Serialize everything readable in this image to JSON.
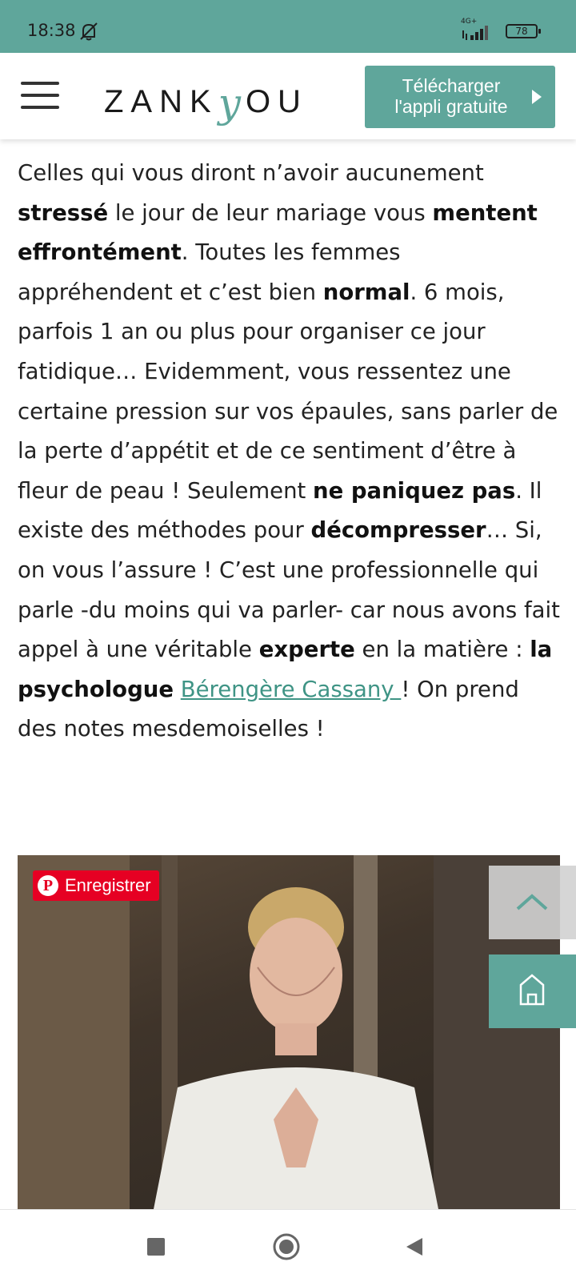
{
  "status_bar": {
    "time": "18:38",
    "network": "4G+",
    "battery": "78"
  },
  "header": {
    "logo_part1": "ZANK",
    "logo_y": "y",
    "logo_part2": "OU",
    "cta_line1": "Télécharger",
    "cta_line2": "l'appli gratuite"
  },
  "article": {
    "p1": "Celles qui vous diront n’avoir aucunement ",
    "b1": "stressé",
    "p2": " le jour de leur mariage vous ",
    "b2": "mentent effrontément",
    "p3": ". Toutes les femmes appréhendent et c’est bien ",
    "b3": "normal",
    "p4": ". 6 mois, parfois 1 an ou plus pour organiser ce jour fatidique… Evidemment, vous ressentez une certaine pression sur vos épaules, sans parler de la perte d’appétit et de ce sentiment d’être à fleur de peau ! Seulement ",
    "b4": "ne paniquez pas",
    "p5": ". Il existe des méthodes pour ",
    "b5": "décompresser",
    "p6": "… Si, on vous l’assure ! C’est une professionnelle qui parle -du moins qui va parler- car nous avons fait appel à une véritable ",
    "b6": "experte",
    "p7": " en la matière : ",
    "b7": "la psychologue",
    "p8": " ",
    "link": "Bérengère Cassany ",
    "p9": "! On prend des notes mesdemoiselles !"
  },
  "photo": {
    "pinterest_label": "Enregistrer"
  },
  "colors": {
    "brand": "#5fa69b",
    "pinterest": "#e60023"
  }
}
